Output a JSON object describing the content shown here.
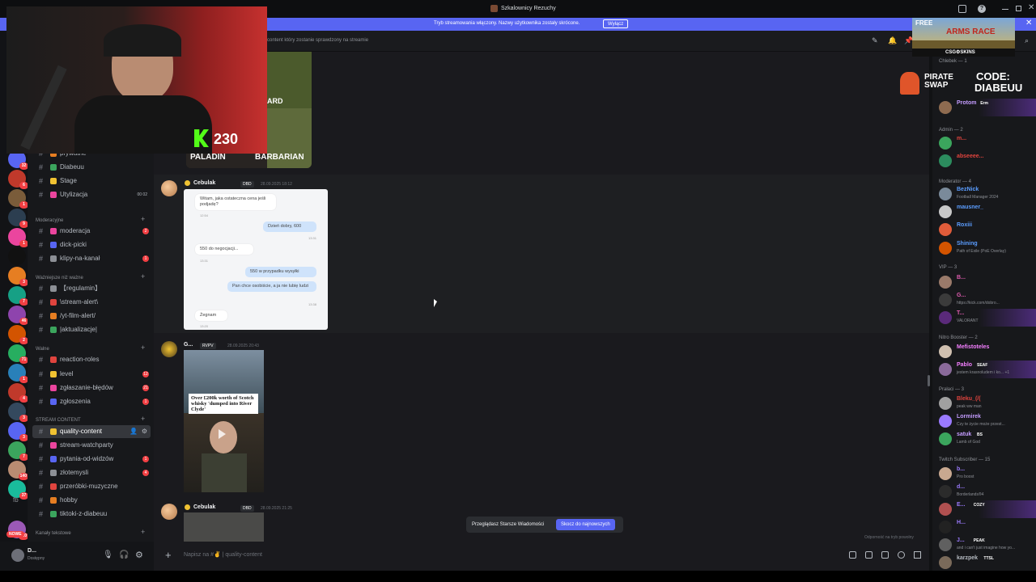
{
  "window": {
    "title": "Szkalownicy Rezuchy"
  },
  "banner": {
    "text": "Tryb streamowania włączony. Nazwy użytkownika zostały skrócone.",
    "button": "Wyłącz"
  },
  "topbar": {
    "topic": "content który zostanie sprawdzony na streamie"
  },
  "overlay": {
    "kick_count": "230",
    "ad_line1": "FREE",
    "ad_line2": "ARMS RACE",
    "ad_brand": "CSG⚙SKINS",
    "sponsor1": "PIRATE SWAP",
    "sponsor2a": "CODE:",
    "sponsor2b": "DIABEUU"
  },
  "servers": [
    {
      "badge": "2"
    },
    {
      "badge": "32"
    },
    {
      "badge": "6"
    },
    {
      "badge": "1"
    },
    {
      "badge": "9"
    },
    {
      "badge": "1"
    },
    {
      "badge": ""
    },
    {
      "badge": "3"
    },
    {
      "badge": "7"
    },
    {
      "badge": "46"
    },
    {
      "badge": "2"
    },
    {
      "badge": "71"
    },
    {
      "badge": "1"
    },
    {
      "badge": "4"
    },
    {
      "badge": "3"
    },
    {
      "badge": "3"
    },
    {
      "badge": "7"
    },
    {
      "badge": "140"
    },
    {
      "badge": "37"
    },
    {
      "badge": ""
    },
    {
      "badge": "220"
    }
  ],
  "rail_labels": {
    "fb": "fb",
    "new": "NOWE"
  },
  "channels": {
    "top": [
      {
        "name": "prywatne",
        "count": ""
      },
      {
        "name": "Diabeuu",
        "count": ""
      },
      {
        "name": "Stage",
        "count": ""
      },
      {
        "name": "Utylizacja",
        "count": "00  02"
      }
    ],
    "cat1": "Moderacyjne",
    "mod": [
      {
        "name": "moderacja",
        "count": "2"
      },
      {
        "name": "dick-picki",
        "count": ""
      },
      {
        "name": "klipy-na-kanał",
        "count": "1"
      }
    ],
    "cat2": "Ważniejsze niż ważne",
    "important": [
      {
        "name": "【regulamin】",
        "count": ""
      },
      {
        "name": "\\stream-alert\\",
        "count": ""
      },
      {
        "name": "/yt-film-alert/",
        "count": ""
      },
      {
        "name": "|aktualizacje|",
        "count": ""
      }
    ],
    "cat3": "Walne",
    "general": [
      {
        "name": "reaction-roles",
        "count": ""
      },
      {
        "name": "level",
        "count": "12"
      },
      {
        "name": "zgłaszanie-błędów",
        "count": "21"
      },
      {
        "name": "zgłoszenia",
        "count": "1"
      }
    ],
    "cat4": "STREAM CONTENT",
    "stream": [
      {
        "name": "quality-content",
        "count": ""
      },
      {
        "name": "stream-watchparty",
        "count": ""
      },
      {
        "name": "pytania-od-widzów",
        "count": "1"
      },
      {
        "name": "złotemysli",
        "count": "4"
      },
      {
        "name": "przeróbki-muzyczne",
        "count": ""
      },
      {
        "name": "hobby",
        "count": ""
      },
      {
        "name": "tiktoki-z-diabeuu",
        "count": ""
      }
    ],
    "cat5": "Kanały tekstowe"
  },
  "user": {
    "name": "D...",
    "status": "Dostępny"
  },
  "messages": {
    "img_labels": {
      "a": "PALADIN",
      "b": "BARBARIAN",
      "c": "ARD"
    },
    "msg1": {
      "author": "Cebulak",
      "tag": "DBD",
      "time": "28.09.2025 18:12",
      "chats": [
        {
          "side": "l",
          "text": "Witam, jaka ostateczna cena jeśli podjadę?",
          "time": "12:54"
        },
        {
          "side": "r",
          "text": "Dzień dobry, 600",
          "time": "13:31"
        },
        {
          "side": "l",
          "text": "550 do negocjacji...",
          "time": "13:31"
        },
        {
          "side": "r",
          "text": "550 w przypadku wysyłki",
          "time": ""
        },
        {
          "side": "r",
          "text": "Pan chce osobiście, a ja nie lubię ludzi",
          "time": "13:38"
        },
        {
          "side": "l",
          "text": "Żegnam",
          "time": "13:20"
        }
      ]
    },
    "msg2": {
      "author": "G...",
      "tag": "RVPV",
      "time": "28.09.2025 20:43",
      "caption": "Over £200k worth of Scotch whisky 'dumped into River Clyde'"
    },
    "msg3": {
      "author": "Cebulak",
      "tag": "DBD",
      "time": "28.09.2025 21:25"
    }
  },
  "jump": {
    "text": "Przeglądasz Starsze Wiadomości",
    "button": "Skocz do najnowszych"
  },
  "composer": {
    "placeholder": "Napisz na #✌ | quality-content",
    "hint": "Odporność na tryb powolny"
  },
  "members": {
    "chlebek": "Chlebek — 1",
    "admin": "Admin — 2",
    "moderator": "Moderator — 4",
    "vip": "VIP — 3",
    "nitro": "Nitro Booster — 2",
    "pralaci": "Prałaci — 3",
    "twitch": "Twitch Subscriber — 15",
    "list": [
      {
        "name": "Protom",
        "status": "",
        "color": "#c49cff",
        "tag": "Erm"
      },
      {
        "name": "m...",
        "status": "",
        "color": "#e0443e",
        "tag": ""
      },
      {
        "name": "abseeee...",
        "status": "",
        "color": "#e0443e",
        "tag": ""
      },
      {
        "name": "BezNick",
        "status": "Football Manager 2024",
        "color": "#5b9dff",
        "tag": ""
      },
      {
        "name": "mausner_",
        "status": "",
        "color": "#5b9dff",
        "tag": ""
      },
      {
        "name": "Roxiii",
        "status": "",
        "color": "#5b9dff",
        "tag": ""
      },
      {
        "name": "Shining",
        "status": "Path of Exile (PoE Overlay)",
        "color": "#5b9dff",
        "tag": ""
      },
      {
        "name": "B...",
        "status": "",
        "color": "#e05cb0",
        "tag": ""
      },
      {
        "name": "G...",
        "status": "https://kick.com/dobro...",
        "color": "#e05cb0",
        "tag": ""
      },
      {
        "name": "T...",
        "status": "VALORANT",
        "color": "#e05cb0",
        "tag": ""
      },
      {
        "name": "Mefistoteles",
        "status": "",
        "color": "#f47fff",
        "tag": ""
      },
      {
        "name": "Pablo",
        "status": "jestem krasnoludem i ko... +1",
        "color": "#f47fff",
        "tag": "SEAF"
      },
      {
        "name": "Bleku_(/(",
        "status": "peak ww man",
        "color": "#e0443e",
        "tag": ""
      },
      {
        "name": "Lormirek",
        "status": "Czy te życie może przest...",
        "color": "#c49cff",
        "tag": ""
      },
      {
        "name": "satuk",
        "status": "Lamb of God",
        "color": "#c49cff",
        "tag": "BS"
      },
      {
        "name": "b...",
        "status": "Pro boost",
        "color": "#9c7bff",
        "tag": ""
      },
      {
        "name": "d...",
        "status": "Borderlands®4",
        "color": "#9c7bff",
        "tag": ""
      },
      {
        "name": "E...",
        "status": "",
        "color": "#9c7bff",
        "tag": "COZY"
      },
      {
        "name": "H...",
        "status": "",
        "color": "#9c7bff",
        "tag": ""
      },
      {
        "name": "J...",
        "status": "and i can't just imagine how yo...",
        "color": "#9c7bff",
        "tag": "PEAK"
      },
      {
        "name": "karzpek",
        "status": "",
        "color": "#b5bac1",
        "tag": "TTSL"
      }
    ]
  }
}
